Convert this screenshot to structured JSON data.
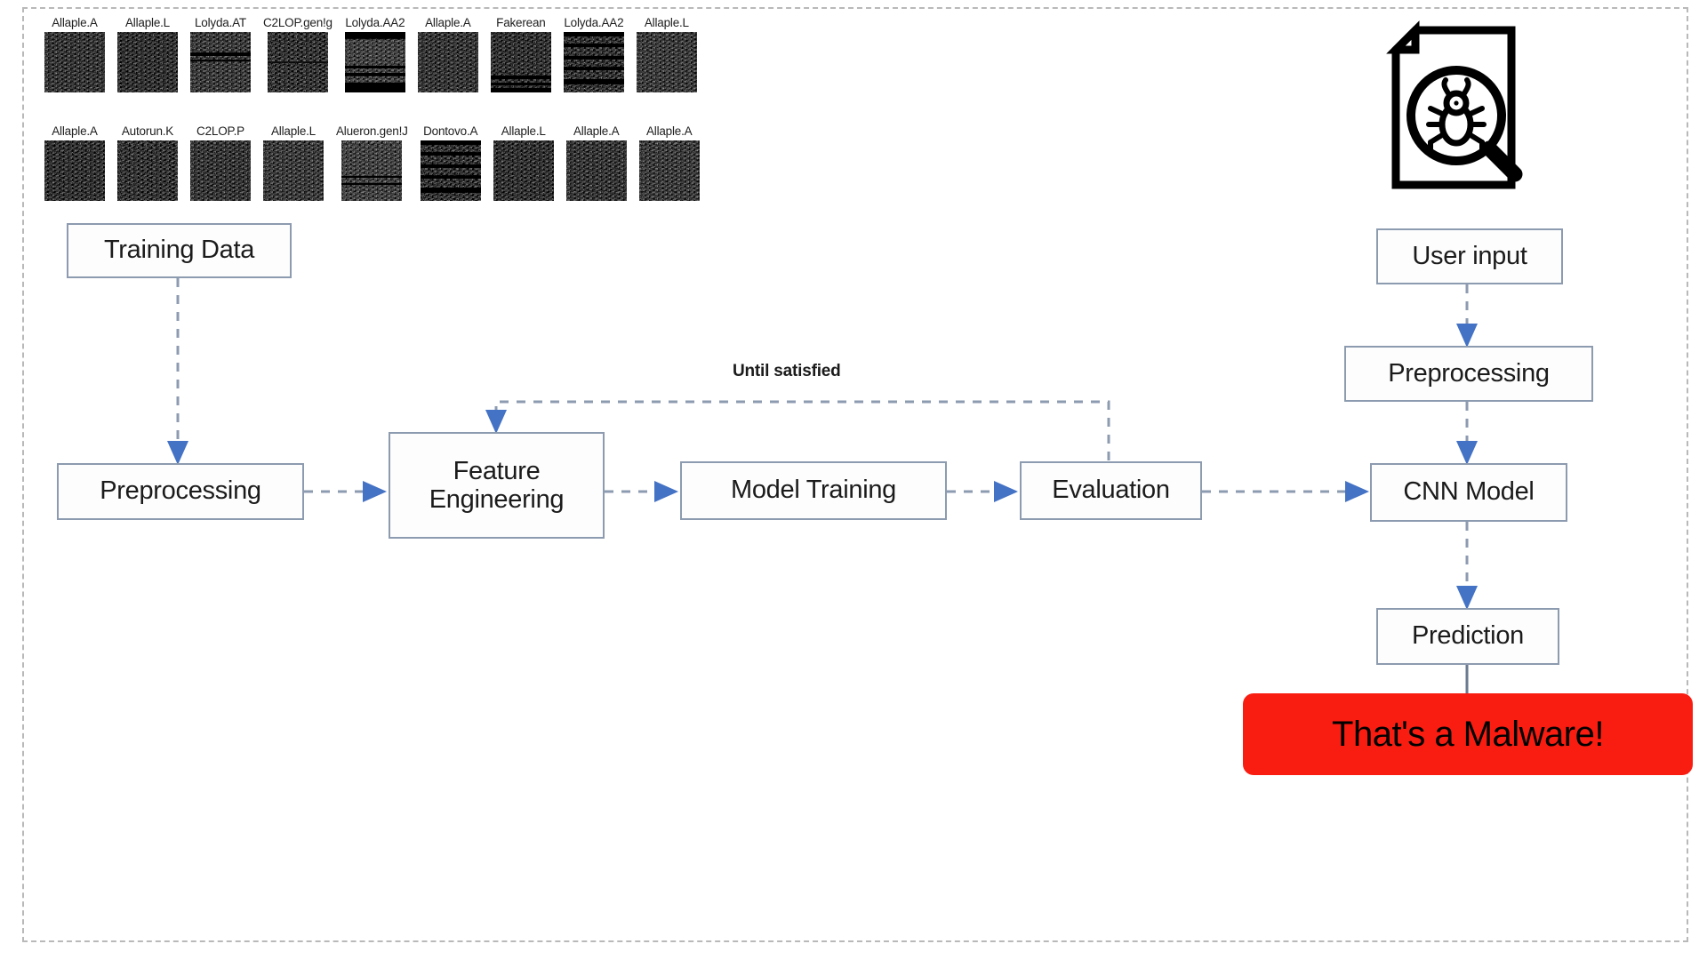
{
  "diagram": {
    "title": "Malware detection CNN pipeline",
    "frame": {
      "style": "dashed",
      "color": "#b9b9b9"
    },
    "colors": {
      "node_border": "#8d9bb0",
      "node_fill": "#fdfdfd",
      "arrow": "#4472c4",
      "connector_dash": "#8d9bb0",
      "alert_background": "#f91d11",
      "alert_text": "#000000",
      "frame_dash": "#b9b9b9",
      "text": "#1b1b1b"
    }
  },
  "samples": {
    "row1": [
      {
        "label": "Allaple.A"
      },
      {
        "label": "Allaple.L"
      },
      {
        "label": "Lolyda.AT"
      },
      {
        "label": "C2LOP.gen!g"
      },
      {
        "label": "Lolyda.AA2"
      },
      {
        "label": "Allaple.A"
      },
      {
        "label": "Fakerean"
      },
      {
        "label": "Lolyda.AA2"
      },
      {
        "label": "Allaple.L"
      }
    ],
    "row2": [
      {
        "label": "Allaple.A"
      },
      {
        "label": "Autorun.K"
      },
      {
        "label": "C2LOP.P"
      },
      {
        "label": "Allaple.L"
      },
      {
        "label": "Alueron.gen!J"
      },
      {
        "label": "Dontovo.A"
      },
      {
        "label": "Allaple.L"
      },
      {
        "label": "Allaple.A"
      },
      {
        "label": "Allaple.A"
      }
    ]
  },
  "training_pipeline": {
    "training_data": "Training Data",
    "preprocessing": "Preprocessing",
    "feature_engineering_line1": "Feature",
    "feature_engineering_line2": "Engineering",
    "model_training": "Model Training",
    "evaluation": "Evaluation",
    "loop_caption": "Until satisfied"
  },
  "inference_pipeline": {
    "icon_name": "document-bug-scan-icon",
    "user_input": "User input",
    "preprocessing": "Preprocessing",
    "cnn_model": "CNN Model",
    "prediction": "Prediction",
    "alert": "That's a Malware!"
  }
}
